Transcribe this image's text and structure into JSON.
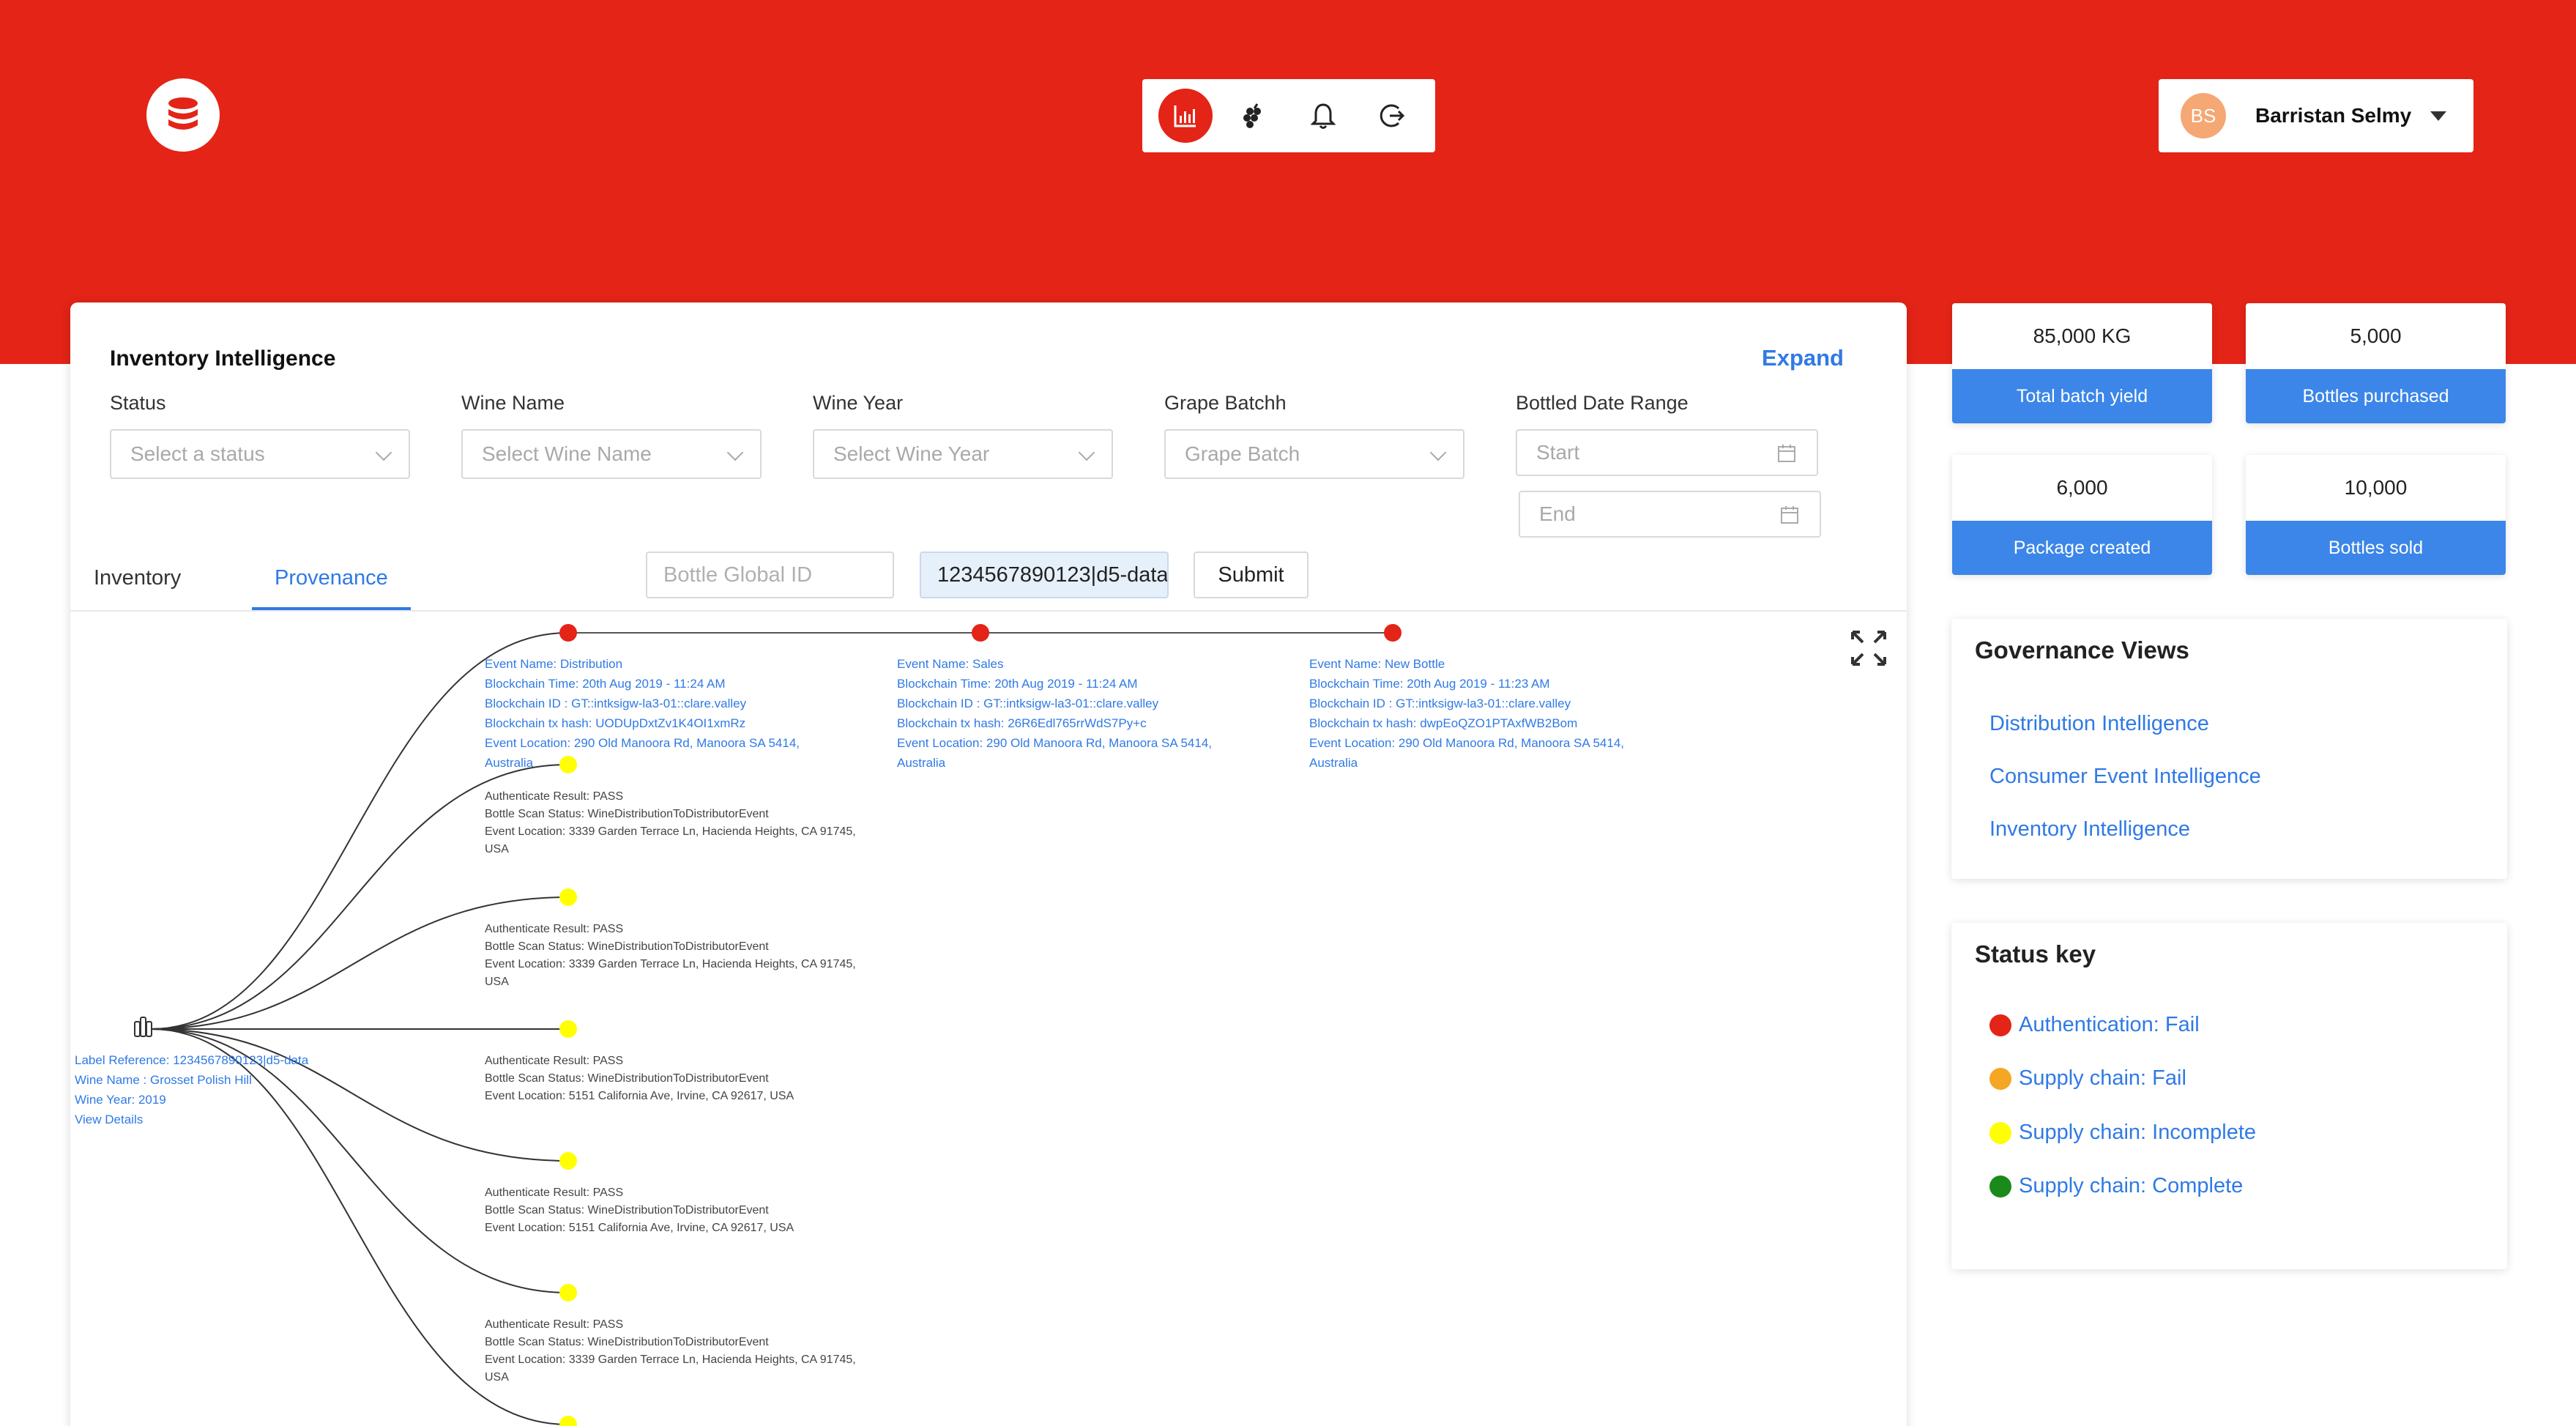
{
  "header": {
    "user_initials": "BS",
    "user_name": "Barristan Selmy",
    "nav_icons": [
      "bar-chart-icon",
      "grapes-icon",
      "bell-icon",
      "logout-icon"
    ]
  },
  "main": {
    "title": "Inventory Intelligence",
    "expand_label": "Expand",
    "filters": {
      "status_label": "Status",
      "status_placeholder": "Select a status",
      "wine_name_label": "Wine Name",
      "wine_name_placeholder": "Select Wine Name",
      "wine_year_label": "Wine Year",
      "wine_year_placeholder": "Select Wine Year",
      "grape_batch_label": "Grape Batchh",
      "grape_batch_placeholder": "Grape Batch",
      "date_range_label": "Bottled Date Range",
      "start_placeholder": "Start",
      "end_placeholder": "End"
    },
    "tabs": [
      {
        "label": "Inventory"
      },
      {
        "label": "Provenance"
      }
    ],
    "active_tab": "Provenance",
    "bottle_id_placeholder": "Bottle Global ID",
    "bottle_id_value": "1234567890123|d5-data",
    "submit_label": "Submit"
  },
  "provenance": {
    "root": [
      "Label Reference: 1234567890123|d5-data",
      "Wine Name : Grosset Polish Hill",
      "Wine Year: 2019",
      "View Details"
    ],
    "events": [
      {
        "lines": [
          "Event Name: Distribution",
          "Blockchain Time: 20th Aug 2019 - 11:24 AM",
          "Blockchain ID : GT::intksigw-la3-01::clare.valley",
          "Blockchain tx hash: UODUpDxtZv1K4OI1xmRz",
          "Event Location: 290 Old Manoora Rd, Manoora SA 5414,",
          "Australia"
        ]
      },
      {
        "lines": [
          "Event Name: Sales",
          "Blockchain Time: 20th Aug 2019 - 11:24 AM",
          "Blockchain ID : GT::intksigw-la3-01::clare.valley",
          "Blockchain tx hash: 26R6Edl765rrWdS7Py+c",
          "Event Location: 290 Old Manoora Rd, Manoora SA 5414,",
          "Australia"
        ]
      },
      {
        "lines": [
          "Event Name: New Bottle",
          "Blockchain Time: 20th Aug 2019 - 11:23 AM",
          "Blockchain ID : GT::intksigw-la3-01::clare.valley",
          "Blockchain tx hash: dwpEoQZO1PTAxfWB2Bom",
          "Event Location: 290 Old Manoora Rd, Manoora SA 5414,",
          "Australia"
        ]
      }
    ],
    "scans": [
      {
        "lines": [
          "Authenticate Result: PASS",
          "Bottle Scan Status: WineDistributionToDistributorEvent",
          "Event Location: 3339 Garden Terrace Ln, Hacienda Heights, CA 91745,",
          "USA"
        ]
      },
      {
        "lines": [
          "Authenticate Result: PASS",
          "Bottle Scan Status: WineDistributionToDistributorEvent",
          "Event Location: 3339 Garden Terrace Ln, Hacienda Heights, CA 91745,",
          "USA"
        ]
      },
      {
        "lines": [
          "Authenticate Result: PASS",
          "Bottle Scan Status: WineDistributionToDistributorEvent",
          "Event Location: 5151 California Ave, Irvine, CA 92617, USA"
        ]
      },
      {
        "lines": [
          "Authenticate Result: PASS",
          "Bottle Scan Status: WineDistributionToDistributorEvent",
          "Event Location: 5151 California Ave, Irvine, CA 92617, USA"
        ]
      },
      {
        "lines": [
          "Authenticate Result: PASS",
          "Bottle Scan Status: WineDistributionToDistributorEvent",
          "Event Location: 3339 Garden Terrace Ln, Hacienda Heights, CA 91745,",
          "USA"
        ]
      }
    ]
  },
  "stats": [
    {
      "value": "85,000 KG",
      "label": "Total batch yield"
    },
    {
      "value": "5,000",
      "label": "Bottles purchased"
    },
    {
      "value": "6,000",
      "label": "Package created"
    },
    {
      "value": "10,000",
      "label": "Bottles sold"
    }
  ],
  "governance": {
    "title": "Governance Views",
    "links": [
      "Distribution Intelligence",
      "Consumer Event Intelligence",
      "Inventory Intelligence"
    ]
  },
  "status_key": {
    "title": "Status key",
    "items": [
      {
        "label": "Authentication: Fail",
        "color": "#e32417"
      },
      {
        "label": "Supply chain: Fail",
        "color": "#f5a623"
      },
      {
        "label": "Supply chain: Incomplete",
        "color": "#ffff00"
      },
      {
        "label": "Supply chain: Complete",
        "color": "#1a8a1a"
      }
    ]
  },
  "colors": {
    "brand_red": "#e32417",
    "link_blue": "#2f7ae5",
    "stat_blue": "#3b86e8",
    "event_dot": "#e32417",
    "scan_dot": "#ffff00"
  }
}
